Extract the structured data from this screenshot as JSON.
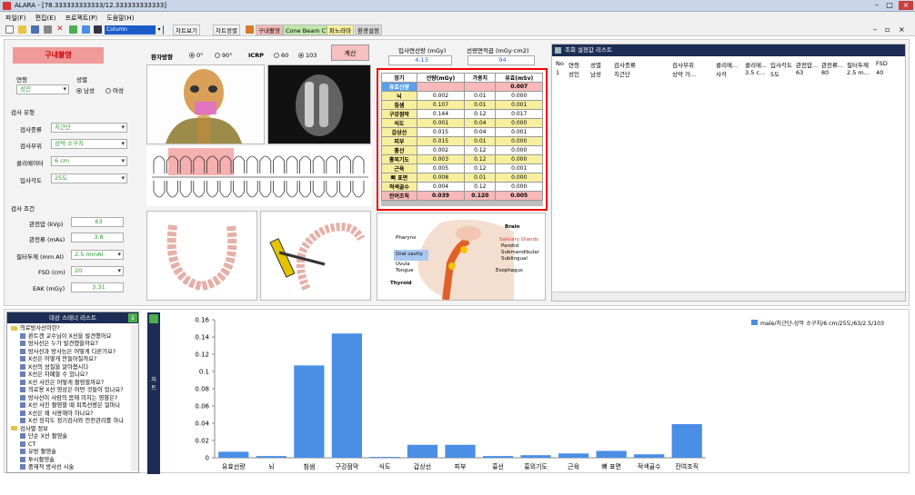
{
  "window": {
    "title": "ALARA - [78.333333333333/12.333333333333]"
  },
  "menu": [
    "파일(F)",
    "편집(E)",
    "프로젝트(P)",
    "도움말(H)"
  ],
  "toolbar": {
    "combo": "Column",
    "chart_show": "차트보기",
    "chart_fit": "차트정렬",
    "tab_oral": "구내촬영",
    "tab_cbct": "Cone Beam CT",
    "tab_pano": "파노라마",
    "tab_env": "환경설정"
  },
  "left": {
    "title": "구내촬영",
    "age_label": "연령",
    "age_value": "성인",
    "sex_label": "성별",
    "sex_male": "남성",
    "sex_female": "여성",
    "exam_type_title": "검사 유형",
    "exam_kind_label": "검사종류",
    "exam_kind_value": "치근단",
    "exam_site_label": "검사부위",
    "exam_site_value": "상악 소구치",
    "collimator_label": "콜리메이터",
    "collimator_value": "6 cm",
    "angle_label": "입사각도",
    "angle_value": "25도",
    "cond_title": "검사 조건",
    "kvp_label": "관전압 (kVp)",
    "kvp_value": "63",
    "mas_label": "관전류 (mAs)",
    "mas_value": "3.8",
    "filter_label": "필터두께 (mm Al)",
    "filter_value": "2.5 mmAl",
    "fsd_label": "FSD (cm)",
    "fsd_value": "20",
    "eak_label": "EAK (mGy)",
    "eak_value": "3.31"
  },
  "center": {
    "patient_dir_label": "환자방향",
    "dir_0": "0°",
    "dir_90": "90°",
    "icrp_label": "ICRP",
    "icrp_60": "60",
    "icrp_103": "103",
    "calc_button": "계산",
    "entrance_dose_label": "입사면선량 (mGy)",
    "entrance_dose_value": "4.13",
    "dap_label": "선량면적곱 (mGy·cm2)",
    "dap_value": "94",
    "anatomy_labels": [
      "Brain",
      "Pharynx",
      "Salivary Glands",
      "Parotid",
      "Submandibular",
      "Sublingual",
      "Oral cavity",
      "Uvula",
      "Tongue",
      "Esophagus",
      "Thyroid"
    ]
  },
  "dose_table": {
    "headers": [
      "장기",
      "선량(mGy)",
      "가중치",
      "유효(mSv)"
    ],
    "effective_row": {
      "organ": "유효선량",
      "value": "0.007"
    },
    "rows": [
      [
        "뇌",
        "0.002",
        "0.01",
        "0.000"
      ],
      [
        "침샘",
        "0.107",
        "0.01",
        "0.001"
      ],
      [
        "구강점막",
        "0.144",
        "0.12",
        "0.017"
      ],
      [
        "식도",
        "0.001",
        "0.04",
        "0.000"
      ],
      [
        "갑상선",
        "0.015",
        "0.04",
        "0.001"
      ],
      [
        "피부",
        "0.015",
        "0.01",
        "0.000"
      ],
      [
        "흉선",
        "0.002",
        "0.12",
        "0.000"
      ],
      [
        "흉외기도",
        "0.003",
        "0.12",
        "0.000"
      ],
      [
        "근육",
        "0.005",
        "0.12",
        "0.001"
      ],
      [
        "뼈 표면",
        "0.008",
        "0.01",
        "0.000"
      ],
      [
        "적색골수",
        "0.004",
        "0.12",
        "0.000"
      ],
      [
        "잔여조직",
        "0.039",
        "0.120",
        "0.005"
      ]
    ]
  },
  "results": {
    "title": "조회 설정값 리스트",
    "headers": [
      "No",
      "연령",
      "성별",
      "검사종류",
      "검사부위",
      "콜리메...",
      "콜리메...",
      "입사각도",
      "관전압...",
      "관전류...",
      "필터두께",
      "FSD"
    ],
    "row": [
      "1",
      "성인",
      "남성",
      "치근단",
      "상악 가...",
      "사각",
      "3.5 c...",
      "5도",
      "63",
      "80",
      "2.5 m...",
      "40"
    ]
  },
  "tree": {
    "title": "대상 스테너 리스트",
    "items": [
      {
        "t": "folder",
        "label": "의료방사선이란?"
      },
      {
        "t": "item",
        "label": "뢴트겐 교수님이 X선을 발견했어요"
      },
      {
        "t": "item",
        "label": "방사선은 누가 발견했을까요?"
      },
      {
        "t": "item",
        "label": "방사선과 방사능은 어떻게 다른가요?"
      },
      {
        "t": "item",
        "label": "X선은 어떻게 만들어질까요?"
      },
      {
        "t": "item",
        "label": "X선의 성질을 알아봅시다"
      },
      {
        "t": "item",
        "label": "X선은 차폐할 수 있나요?"
      },
      {
        "t": "item",
        "label": "X선 사진은 어떻게 촬영할까요?"
      },
      {
        "t": "item",
        "label": "의료용 X선 영상은 어떤 것들이 있나요?"
      },
      {
        "t": "item",
        "label": "방사선이 사람의 몸에 미치는 영향은?"
      },
      {
        "t": "item",
        "label": "X선 사진 촬영할 때 피폭선량은 얼마나"
      },
      {
        "t": "item",
        "label": "X선은 왜 사용해야 하나요?"
      },
      {
        "t": "item",
        "label": "X선 장치도 정기검사와 안전관리를 하나"
      },
      {
        "t": "folder",
        "label": "검사별 정보"
      },
      {
        "t": "item",
        "label": "단순 X선 촬영술"
      },
      {
        "t": "item",
        "label": "CT"
      },
      {
        "t": "item",
        "label": "유방 촬영술"
      },
      {
        "t": "item",
        "label": "투시촬영술"
      },
      {
        "t": "item",
        "label": "중재적 방사선 시술"
      }
    ]
  },
  "chart_strip_label": "차 트",
  "chart_data": {
    "type": "bar",
    "categories": [
      "유효선량",
      "뇌",
      "침샘",
      "구강점막",
      "식도",
      "갑상선",
      "피부",
      "흉선",
      "흉외기도",
      "근육",
      "뼈 표면",
      "적색골수",
      "잔여조직"
    ],
    "series": [
      {
        "name": "male/치근단-상악 소구치/6 cm/25도/63/2.5/103",
        "values": [
          0.007,
          0.002,
          0.107,
          0.144,
          0.001,
          0.015,
          0.015,
          0.002,
          0.003,
          0.005,
          0.008,
          0.004,
          0.039
        ]
      }
    ],
    "ylim": [
      0,
      0.16
    ],
    "yticks": [
      "0",
      "0.02",
      "0.04",
      "0.06",
      "0.08",
      "0.1",
      "0.12",
      "0.14",
      "0.16"
    ],
    "legend": "top-right",
    "color": "#4a8ee6"
  }
}
